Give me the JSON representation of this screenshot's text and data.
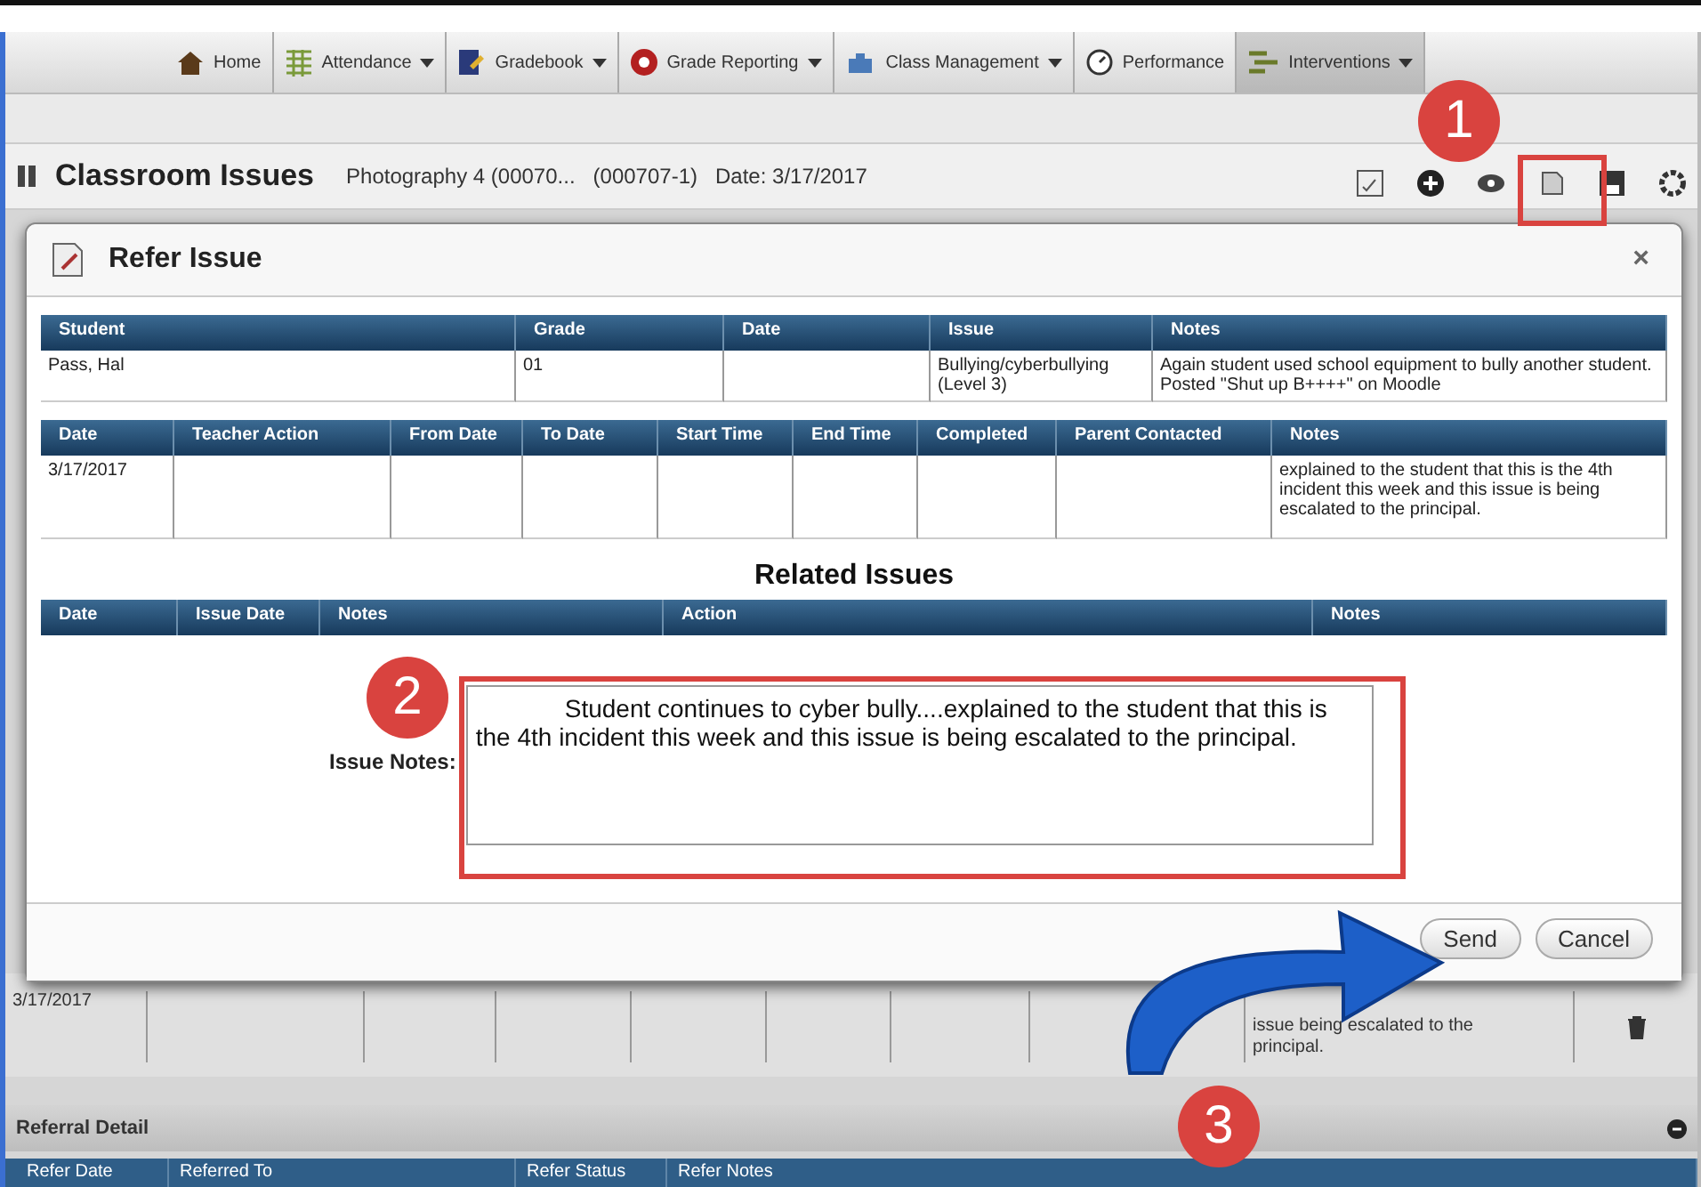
{
  "nav": {
    "tabs": [
      {
        "label": "Home",
        "has_menu": false,
        "selected": false
      },
      {
        "label": "Attendance",
        "has_menu": true,
        "selected": false
      },
      {
        "label": "Gradebook",
        "has_menu": true,
        "selected": false
      },
      {
        "label": "Grade Reporting",
        "has_menu": true,
        "selected": false
      },
      {
        "label": "Class Management",
        "has_menu": true,
        "selected": false
      },
      {
        "label": "Performance",
        "has_menu": false,
        "selected": false
      },
      {
        "label": "Interventions",
        "has_menu": true,
        "selected": true
      }
    ]
  },
  "header": {
    "title": "Classroom Issues",
    "course": "Photography 4 (00070...",
    "section": "(000707-1)",
    "date": "Date: 3/17/2017"
  },
  "background_row": {
    "date": "3/17/2017",
    "notes": [
      "issue being escalated to the",
      "principal."
    ]
  },
  "referral_detail": {
    "title": "Referral Detail",
    "columns": [
      "Refer Date",
      "Referred To",
      "Refer Status",
      "Refer Notes"
    ]
  },
  "dialog": {
    "title": "Refer Issue",
    "close": "×",
    "student_table": {
      "columns": [
        "Student",
        "Grade",
        "Date",
        "Issue",
        "Notes"
      ],
      "rows": [
        [
          "Pass, Hal",
          "01",
          null,
          "Bullying/cyberbullying (Level 3)",
          "Again student used school equipment to bully another student. Posted \"Shut up B++++\" on Moodle"
        ]
      ]
    },
    "action_table": {
      "columns": [
        "Date",
        "Teacher Action",
        "From Date",
        "To Date",
        "Start Time",
        "End Time",
        "Completed",
        "Parent Contacted",
        "Notes"
      ],
      "rows": [
        [
          "3/17/2017",
          null,
          null,
          null,
          null,
          null,
          null,
          null,
          "explained to the student that this is the 4th incident this week and this issue is being escalated to the principal."
        ]
      ]
    },
    "related_issues": {
      "title": "Related Issues",
      "columns": [
        "Date",
        "Issue Date",
        "Notes",
        "Action",
        "Notes"
      ]
    },
    "issue_notes": {
      "label": "Issue Notes:",
      "value": "Student continues to cyber bully....explained to the student that this is the 4th incident this week and this issue is being escalated to the principal."
    },
    "buttons": [
      "Send",
      "Cancel"
    ]
  },
  "steps": [
    "1",
    "2",
    "3"
  ]
}
